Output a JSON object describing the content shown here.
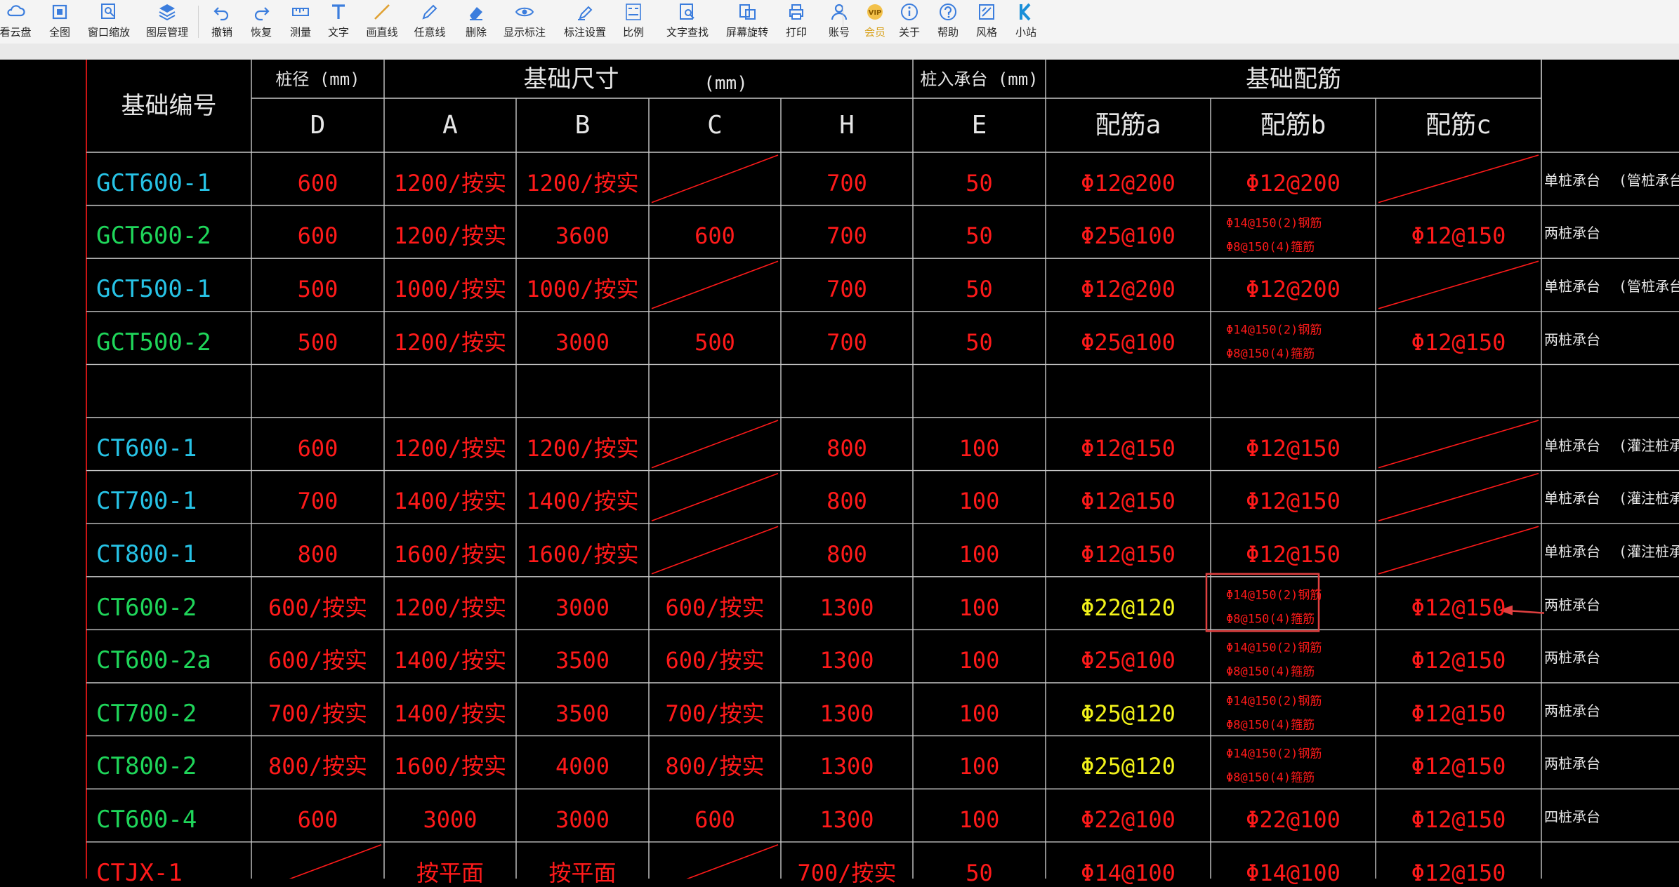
{
  "toolbar": {
    "items": [
      {
        "label": "看云盘",
        "icon": "cloud-icon"
      },
      {
        "label": "全图",
        "icon": "fit-all-icon"
      },
      {
        "label": "窗口缩放",
        "icon": "window-zoom-icon"
      },
      {
        "label": "图层管理",
        "icon": "layers-icon"
      },
      {
        "label": "撤销",
        "icon": "undo-icon"
      },
      {
        "label": "恢复",
        "icon": "redo-icon"
      },
      {
        "label": "测量",
        "icon": "measure-icon"
      },
      {
        "label": "文字",
        "icon": "text-icon"
      },
      {
        "label": "画直线",
        "icon": "line-icon"
      },
      {
        "label": "任意线",
        "icon": "freehand-icon"
      },
      {
        "label": "删除",
        "icon": "eraser-icon"
      },
      {
        "label": "显示标注",
        "icon": "eye-icon"
      },
      {
        "label": "标注设置",
        "icon": "annotation-settings-icon"
      },
      {
        "label": "比例",
        "icon": "scale-icon"
      },
      {
        "label": "文字查找",
        "icon": "text-search-icon"
      },
      {
        "label": "屏幕旋转",
        "icon": "rotate-screen-icon"
      },
      {
        "label": "打印",
        "icon": "print-icon"
      },
      {
        "label": "账号",
        "icon": "user-icon"
      },
      {
        "label": "会员",
        "icon": "vip-icon"
      },
      {
        "label": "关于",
        "icon": "info-icon"
      },
      {
        "label": "帮助",
        "icon": "help-icon"
      },
      {
        "label": "风格",
        "icon": "style-icon"
      },
      {
        "label": "小站",
        "icon": "station-k-icon"
      }
    ]
  },
  "colors": {
    "toolbar_bg": "#f4f4f4",
    "toolbar_icon": "#3b7ddd",
    "vip": "#d9a320",
    "canvas_bg": "#000000",
    "grid_line": "#c8c8c8",
    "red": "#ff1a1a",
    "green": "#1fd65a",
    "cyan": "#27c3e6",
    "yellow": "#f2f21a",
    "white": "#e6e6e6",
    "annot": "#e04040"
  },
  "table": {
    "header": {
      "id": "基础编号",
      "pile_group": "桩径 (mm)",
      "size_group": "基础尺寸",
      "size_unit": "(mm)",
      "embed_group": "桩入承台 (mm)",
      "rebar_group": "基础配筋",
      "cols": [
        "D",
        "A",
        "B",
        "C",
        "H",
        "E",
        "配筋a",
        "配筋b",
        "配筋c"
      ]
    },
    "rows": [
      {
        "id": "GCT600-1",
        "idc": "cyan",
        "D": "600",
        "A": "1200/按实",
        "B": "1200/按实",
        "C": "",
        "H": "700",
        "E": "50",
        "a": "Φ12@200",
        "ac": "red",
        "b": [
          "Φ12@200"
        ],
        "c": "",
        "note1": "单桩承台",
        "note2": "(管桩承台)"
      },
      {
        "id": "GCT600-2",
        "idc": "green",
        "D": "600",
        "A": "1200/按实",
        "B": "3600",
        "C": "600",
        "H": "700",
        "E": "50",
        "a": "Φ25@100",
        "ac": "red",
        "b": [
          "Φ14@150(2)钢筋",
          "Φ8@150(4)箍筋"
        ],
        "c": "Φ12@150",
        "note1": "两桩承台",
        "note2": ""
      },
      {
        "id": "GCT500-1",
        "idc": "cyan",
        "D": "500",
        "A": "1000/按实",
        "B": "1000/按实",
        "C": "",
        "H": "700",
        "E": "50",
        "a": "Φ12@200",
        "ac": "red",
        "b": [
          "Φ12@200"
        ],
        "c": "",
        "note1": "单桩承台",
        "note2": "(管桩承台)"
      },
      {
        "id": "GCT500-2",
        "idc": "green",
        "D": "500",
        "A": "1200/按实",
        "B": "3000",
        "C": "500",
        "H": "700",
        "E": "50",
        "a": "Φ25@100",
        "ac": "red",
        "b": [
          "Φ14@150(2)钢筋",
          "Φ8@150(4)箍筋"
        ],
        "c": "Φ12@150",
        "note1": "两桩承台",
        "note2": ""
      },
      {
        "id": "",
        "idc": "cyan",
        "D": "",
        "A": "",
        "B": "",
        "C": "-",
        "H": "",
        "E": "",
        "a": "",
        "ac": "red",
        "b": [],
        "c": "-",
        "note1": "",
        "note2": "",
        "blank": true
      },
      {
        "id": "CT600-1",
        "idc": "cyan",
        "D": "600",
        "A": "1200/按实",
        "B": "1200/按实",
        "C": "",
        "H": "800",
        "E": "100",
        "a": "Φ12@150",
        "ac": "red",
        "b": [
          "Φ12@150"
        ],
        "c": "",
        "note1": "单桩承台",
        "note2": "(灌注桩承台)"
      },
      {
        "id": "CT700-1",
        "idc": "cyan",
        "D": "700",
        "A": "1400/按实",
        "B": "1400/按实",
        "C": "",
        "H": "800",
        "E": "100",
        "a": "Φ12@150",
        "ac": "red",
        "b": [
          "Φ12@150"
        ],
        "c": "",
        "note1": "单桩承台",
        "note2": "(灌注桩承台)"
      },
      {
        "id": "CT800-1",
        "idc": "cyan",
        "D": "800",
        "A": "1600/按实",
        "B": "1600/按实",
        "C": "",
        "H": "800",
        "E": "100",
        "a": "Φ12@150",
        "ac": "red",
        "b": [
          "Φ12@150"
        ],
        "c": "",
        "note1": "单桩承台",
        "note2": "(灌注桩承台)"
      },
      {
        "id": "CT600-2",
        "idc": "green",
        "D": "600/按实",
        "A": "1200/按实",
        "B": "3000",
        "C": "600/按实",
        "H": "1300",
        "E": "100",
        "a": "Φ22@120",
        "ac": "yellow",
        "b": [
          "Φ14@150(2)钢筋",
          "Φ8@150(4)箍筋"
        ],
        "c": "Φ12@150",
        "note1": "两桩承台",
        "note2": "",
        "highlight": true
      },
      {
        "id": "CT600-2a",
        "idc": "green",
        "D": "600/按实",
        "A": "1400/按实",
        "B": "3500",
        "C": "600/按实",
        "H": "1300",
        "E": "100",
        "a": "Φ25@100",
        "ac": "red",
        "b": [
          "Φ14@150(2)钢筋",
          "Φ8@150(4)箍筋"
        ],
        "c": "Φ12@150",
        "note1": "两桩承台",
        "note2": ""
      },
      {
        "id": "CT700-2",
        "idc": "green",
        "D": "700/按实",
        "A": "1400/按实",
        "B": "3500",
        "C": "700/按实",
        "H": "1300",
        "E": "100",
        "a": "Φ25@120",
        "ac": "yellow",
        "b": [
          "Φ14@150(2)钢筋",
          "Φ8@150(4)箍筋"
        ],
        "c": "Φ12@150",
        "note1": "两桩承台",
        "note2": ""
      },
      {
        "id": "CT800-2",
        "idc": "green",
        "D": "800/按实",
        "A": "1600/按实",
        "B": "4000",
        "C": "800/按实",
        "H": "1300",
        "E": "100",
        "a": "Φ25@120",
        "ac": "yellow",
        "b": [
          "Φ14@150(2)钢筋",
          "Φ8@150(4)箍筋"
        ],
        "c": "Φ12@150",
        "note1": "两桩承台",
        "note2": ""
      },
      {
        "id": "CT600-4",
        "idc": "green",
        "D": "600",
        "A": "3000",
        "B": "3000",
        "C": "600",
        "H": "1300",
        "E": "100",
        "a": "Φ22@100",
        "ac": "red",
        "b": [
          "Φ22@100"
        ],
        "c": "Φ12@150",
        "note1": "四桩承台",
        "note2": ""
      },
      {
        "id": "CTJX-1",
        "idc": "red",
        "D": "",
        "A": "按平面",
        "B": "按平面",
        "C": "",
        "H": "700/按实",
        "E": "50",
        "a": "Φ14@100",
        "ac": "red",
        "b": [
          "Φ14@100"
        ],
        "c": "Φ12@150",
        "note1": "",
        "note2": ""
      }
    ]
  }
}
